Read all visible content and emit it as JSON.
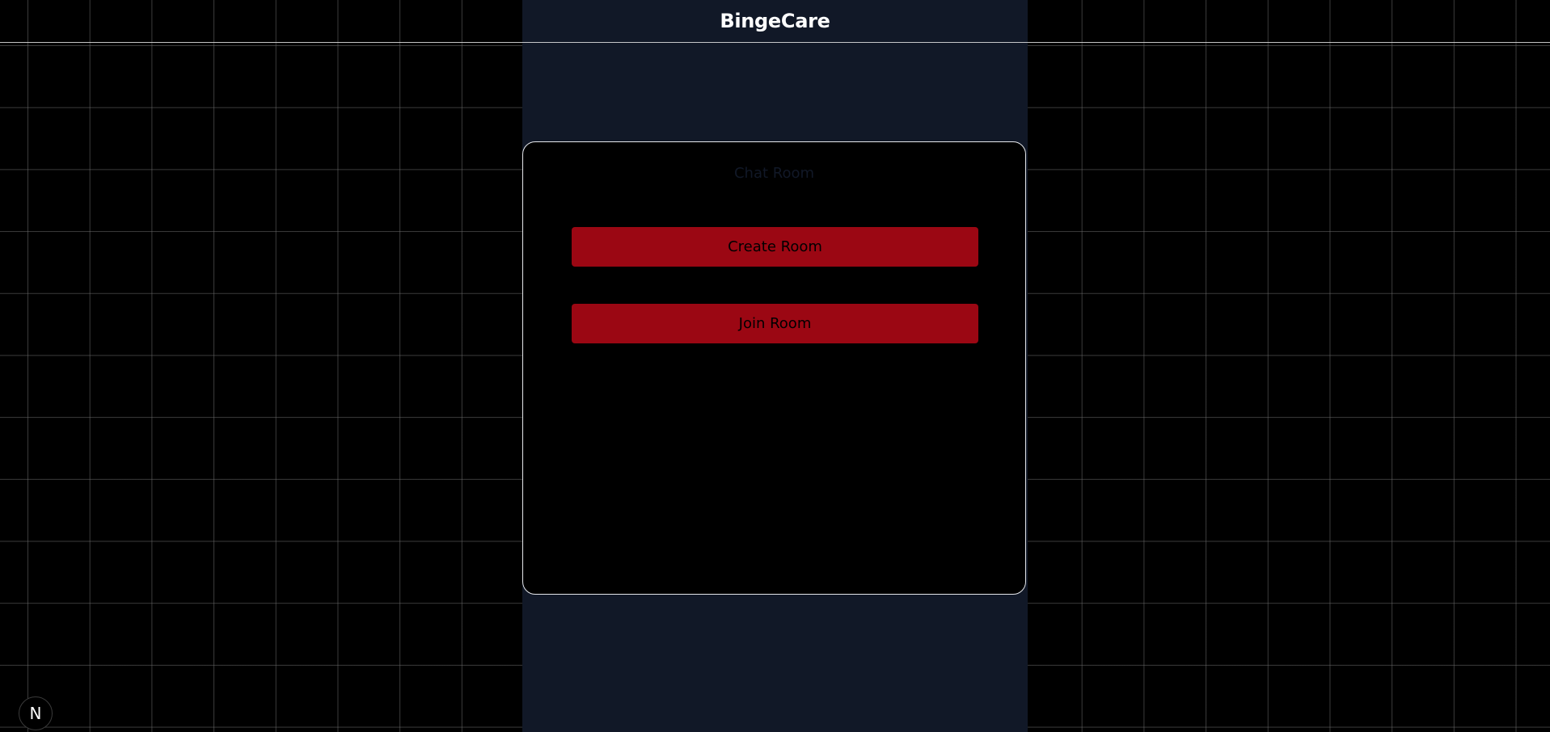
{
  "app": {
    "brand": "BingeCare"
  },
  "chat_card": {
    "title": "Chat Room",
    "buttons": {
      "create_label": "Create Room",
      "join_label": "Join Room"
    }
  },
  "dev_badge": {
    "label": "N",
    "icon": "nextjs-icon"
  },
  "colors": {
    "page_background": "#000000",
    "center_column": "#111827",
    "button_background": "#9b0713",
    "card_border": "#e5e7eb",
    "grid_line": "#787878"
  }
}
